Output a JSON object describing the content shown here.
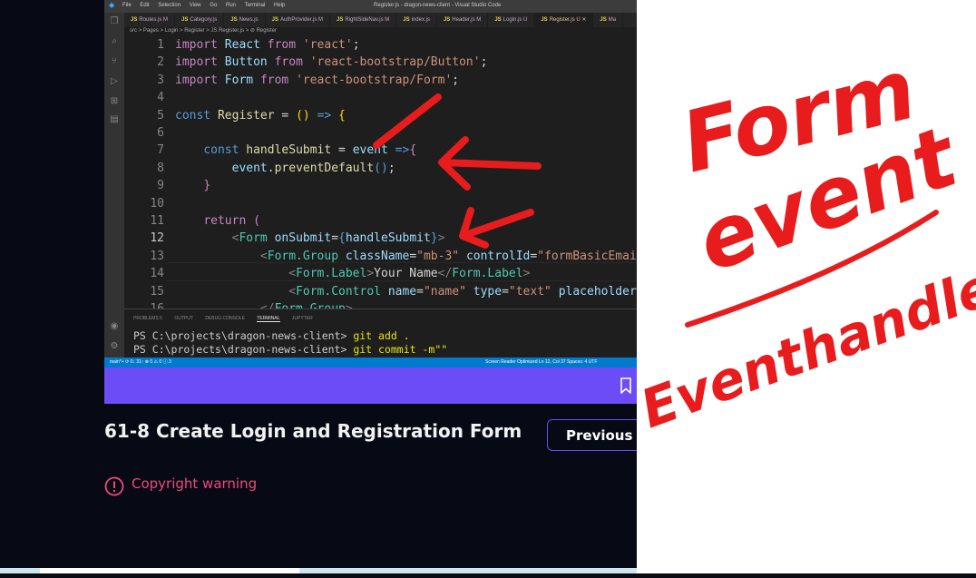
{
  "vscode": {
    "menus": [
      "File",
      "Edit",
      "Selection",
      "View",
      "Go",
      "Run",
      "Terminal",
      "Help"
    ],
    "window_title": "Register.js - dragon-news-client - Visual Studio Code",
    "tabs": [
      {
        "label": "Routes.js M"
      },
      {
        "label": "Category.js"
      },
      {
        "label": "News.js"
      },
      {
        "label": "AuthProvider.js M"
      },
      {
        "label": "RightSideNav.js M"
      },
      {
        "label": "index.js"
      },
      {
        "label": "Header.js M"
      },
      {
        "label": "Login.js U"
      },
      {
        "label": "Register.js U"
      },
      {
        "label": "Ma"
      }
    ],
    "breadcrumb": "src > Pages > Login > Register > JS Register.js > ⊘ Register",
    "line_numbers": [
      "1",
      "2",
      "3",
      "4",
      "5",
      "6",
      "7",
      "8",
      "9",
      "10",
      "11",
      "12",
      "13",
      "14",
      "15",
      "16"
    ],
    "panel_tabs": [
      "PROBLEMS 5",
      "OUTPUT",
      "DEBUG CONSOLE",
      "TERMINAL",
      "JUPYTER"
    ],
    "terminal": [
      {
        "prompt": "PS C:\\projects\\dragon-news-client> ",
        "cmd": "git add ."
      },
      {
        "prompt": "PS C:\\projects\\dragon-news-client> ",
        "cmd": "git commit -m\"\""
      }
    ],
    "status_left": "main*+   ⟳ 0↓ 31↑   ⊗ 0 ⚠ 0 ⓘ 3",
    "status_right": "Screen Reader Optimized     Ln 12, Col 37     Spaces: 4     UTF"
  },
  "lesson": {
    "title": "61-8 Create Login and Registration Form",
    "previous_label": "Previous",
    "copyright_warning": "Copyright warning"
  },
  "annotation": {
    "lines": [
      "Form",
      "event",
      "Eventhandler"
    ]
  },
  "colors": {
    "accent": "#6b4cf6",
    "warning": "#f0487a",
    "annotation_red": "#e81c1c"
  }
}
